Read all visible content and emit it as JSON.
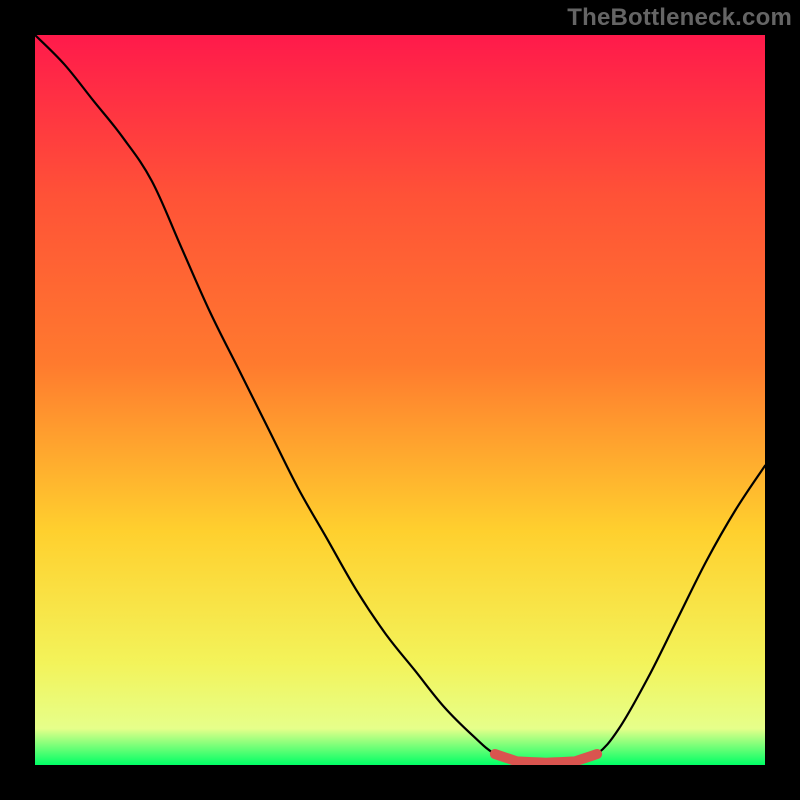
{
  "watermark": "TheBottleneck.com",
  "gradient": {
    "top": "#ff1a4b",
    "upper_mid": "#ff7a2e",
    "mid": "#ffd02e",
    "lower_mid": "#f3f35a",
    "low": "#e6ff8a",
    "bottom": "#00ff66"
  },
  "chart_data": {
    "type": "line",
    "title": "",
    "xlabel": "",
    "ylabel": "",
    "x_range": [
      0,
      100
    ],
    "y_range": [
      0,
      100
    ],
    "note": "Curve is a bottleneck profile: high mismatch on left, dips to near-zero (optimal) around x≈64–76, rises again to the right. Values read from plot geometry (percent of axis).",
    "x": [
      0,
      4,
      8,
      12,
      16,
      20,
      24,
      28,
      32,
      36,
      40,
      44,
      48,
      52,
      56,
      60,
      63,
      66,
      70,
      74,
      77,
      80,
      84,
      88,
      92,
      96,
      100
    ],
    "y": [
      100,
      96,
      91,
      86,
      80,
      71,
      62,
      54,
      46,
      38,
      31,
      24,
      18,
      13,
      8,
      4,
      1.5,
      0.5,
      0.3,
      0.5,
      1.5,
      5,
      12,
      20,
      28,
      35,
      41
    ],
    "trough_band_x": [
      63,
      77
    ],
    "trough_color": "#d9544f"
  }
}
